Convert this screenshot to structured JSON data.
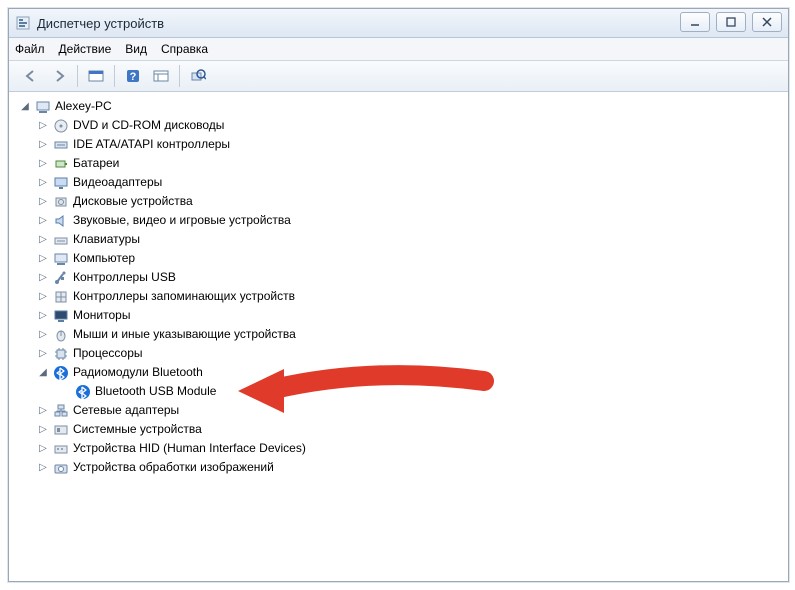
{
  "window": {
    "title": "Диспетчер устройств"
  },
  "menu": {
    "file": "Файл",
    "action": "Действие",
    "view": "Вид",
    "help": "Справка"
  },
  "root": {
    "name": "Alexey-PC"
  },
  "categories": [
    {
      "label": "DVD и CD-ROM дисководы",
      "icon": "disc"
    },
    {
      "label": "IDE ATA/ATAPI контроллеры",
      "icon": "ide"
    },
    {
      "label": "Батареи",
      "icon": "battery"
    },
    {
      "label": "Видеоадаптеры",
      "icon": "display"
    },
    {
      "label": "Дисковые устройства",
      "icon": "hdd"
    },
    {
      "label": "Звуковые, видео и игровые устройства",
      "icon": "sound"
    },
    {
      "label": "Клавиатуры",
      "icon": "keyboard"
    },
    {
      "label": "Компьютер",
      "icon": "computer"
    },
    {
      "label": "Контроллеры USB",
      "icon": "usb"
    },
    {
      "label": "Контроллеры запоминающих устройств",
      "icon": "storage"
    },
    {
      "label": "Мониторы",
      "icon": "monitor"
    },
    {
      "label": "Мыши и иные указывающие устройства",
      "icon": "mouse"
    },
    {
      "label": "Процессоры",
      "icon": "cpu"
    },
    {
      "label": "Радиомодули Bluetooth",
      "icon": "bluetooth",
      "expanded": true,
      "children": [
        {
          "label": "Bluetooth USB Module",
          "icon": "bluetooth"
        }
      ]
    },
    {
      "label": "Сетевые адаптеры",
      "icon": "network"
    },
    {
      "label": "Системные устройства",
      "icon": "system"
    },
    {
      "label": "Устройства HID (Human Interface Devices)",
      "icon": "hid"
    },
    {
      "label": "Устройства обработки изображений",
      "icon": "imaging"
    }
  ]
}
